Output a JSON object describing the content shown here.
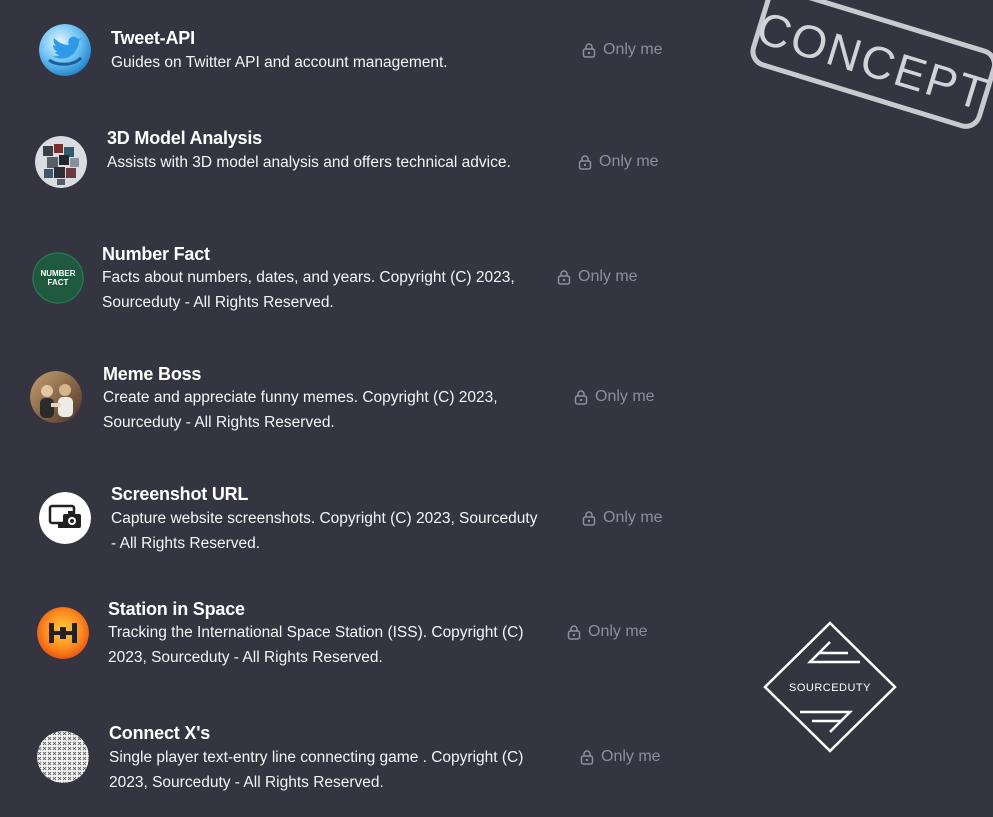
{
  "watermark": {
    "stamp_text": "CONCEPT",
    "logo_text": "SOURCEDUTY"
  },
  "gpts": [
    {
      "name": "Tweet-API",
      "description": "Guides on Twitter API and account management.",
      "visibility": "Only me",
      "icon": "twitter-bird-icon"
    },
    {
      "name": "3D Model Analysis",
      "description": "Assists with 3D model analysis and offers technical advice.",
      "visibility": "Only me",
      "icon": "3d-cubes-icon"
    },
    {
      "name": "Number Fact",
      "description": "Facts about numbers, dates, and years. Copyright (C) 2023, Sourceduty - All Rights Reserved.",
      "visibility": "Only me",
      "icon": "number-fact-icon",
      "icon_text": "NUMBER FACT"
    },
    {
      "name": "Meme Boss",
      "description": "Create and appreciate funny memes. Copyright (C) 2023, Sourceduty - All Rights Reserved.",
      "visibility": "Only me",
      "icon": "meme-boss-icon"
    },
    {
      "name": "Screenshot URL",
      "description": "Capture website screenshots. Copyright (C) 2023, Sourceduty - All Rights Reserved.",
      "visibility": "Only me",
      "icon": "screenshot-camera-icon"
    },
    {
      "name": "Station in Space",
      "description": "Tracking the International Space Station (ISS). Copyright (C) 2023, Sourceduty - All Rights Reserved.",
      "visibility": "Only me",
      "icon": "space-station-icon"
    },
    {
      "name": "Connect X's",
      "description": "Single player text-entry line connecting game . Copyright (C) 2023, Sourceduty - All Rights Reserved.",
      "visibility": "Only me",
      "icon": "x-grid-icon"
    }
  ]
}
